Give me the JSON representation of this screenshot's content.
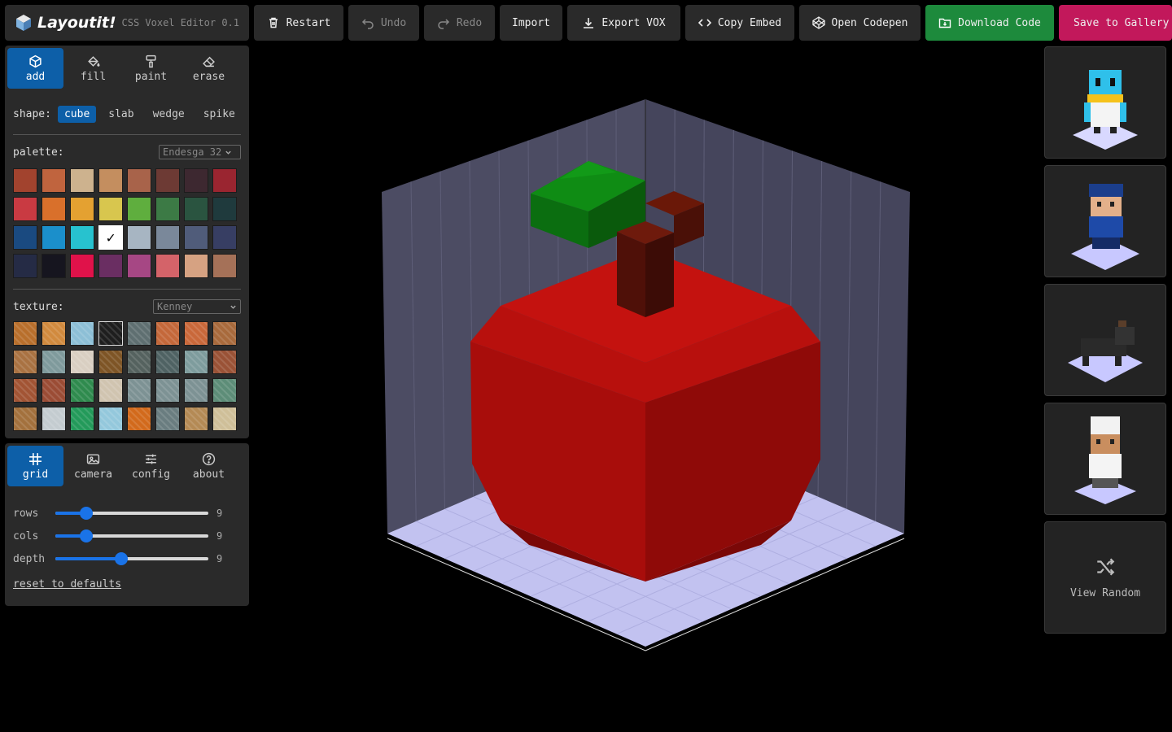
{
  "app": {
    "title": "Layoutit!",
    "version": "CSS Voxel Editor 0.1"
  },
  "toolbar": {
    "restart": "Restart",
    "undo": "Undo",
    "redo": "Redo",
    "import": "Import",
    "export": "Export VOX",
    "copy_embed": "Copy Embed",
    "codepen": "Open Codepen",
    "download": "Download Code",
    "save": "Save to Gallery"
  },
  "tools": [
    {
      "label": "add",
      "icon": "cube-icon",
      "active": true
    },
    {
      "label": "fill",
      "icon": "paint-bucket-icon",
      "active": false
    },
    {
      "label": "paint",
      "icon": "paint-roller-icon",
      "active": false
    },
    {
      "label": "erase",
      "icon": "eraser-icon",
      "active": false
    }
  ],
  "shape": {
    "label": "shape:",
    "options": [
      "cube",
      "slab",
      "wedge",
      "spike"
    ],
    "selected": "cube"
  },
  "palette": {
    "label": "palette:",
    "selected_name": "Endesga 32",
    "selected_index": 19,
    "colors": [
      "#a2432e",
      "#c0643e",
      "#cdb28e",
      "#c48e5f",
      "#a8634a",
      "#6d3a34",
      "#3d2830",
      "#9a2530",
      "#c93a42",
      "#d9702b",
      "#e4a131",
      "#d8c64e",
      "#5fae3e",
      "#3c7a45",
      "#2a5440",
      "#1f3a3d",
      "#1a4a80",
      "#1b8fcb",
      "#27c2cf",
      "#ffffff",
      "#a7b5c2",
      "#7a889a",
      "#505c7a",
      "#373e63",
      "#252b45",
      "#16151f",
      "#e0124a",
      "#6a2e62",
      "#a64784",
      "#d46369",
      "#d6a282",
      "#a57158"
    ]
  },
  "texture": {
    "label": "texture:",
    "selected_name": "Kenney",
    "selected_index": 3,
    "tiles": [
      "#b86f2c",
      "#d18a3e",
      "#8dbfd6",
      "#1e1e1e",
      "#5f6f71",
      "#c4683a",
      "#c9683a",
      "#a86a3c",
      "#a97242",
      "#7f9a9c",
      "#d9cfc2",
      "#7e5526",
      "#55625f",
      "#4f6263",
      "#7e9c9d",
      "#9a5236",
      "#a25434",
      "#9b4c35",
      "#2f8b4e",
      "#d0c4b0",
      "#7d9294",
      "#7d9294",
      "#7d9294",
      "#5d8d78",
      "#a3713d",
      "#c4ccd0",
      "#239a5a",
      "#94c8dc",
      "#d26a1c",
      "#6a7d80",
      "#b48a55",
      "#cfbf99"
    ]
  },
  "settings_tabs": [
    {
      "label": "grid",
      "icon": "grid-icon",
      "active": true
    },
    {
      "label": "camera",
      "icon": "camera-icon",
      "active": false
    },
    {
      "label": "config",
      "icon": "sliders-icon",
      "active": false
    },
    {
      "label": "about",
      "icon": "help-icon",
      "active": false
    }
  ],
  "grid": {
    "rows": {
      "label": "rows",
      "value": "9",
      "fraction": 0.2
    },
    "cols": {
      "label": "cols",
      "value": "9",
      "fraction": 0.2
    },
    "depth": {
      "label": "depth",
      "value": "9",
      "fraction": 0.43
    },
    "reset": "reset to defaults"
  },
  "gallery": {
    "items": [
      "penguin-model",
      "police-officer-model",
      "black-cat-model",
      "chef-model"
    ],
    "random": "View Random"
  },
  "colors": {
    "accent_blue": "#0d5fa8",
    "download_green": "#1d8a3c",
    "save_pink": "#c2185b",
    "apple_red": "#c4100e",
    "leaf_green": "#1a8a14",
    "stem_brown": "#5a1608"
  }
}
